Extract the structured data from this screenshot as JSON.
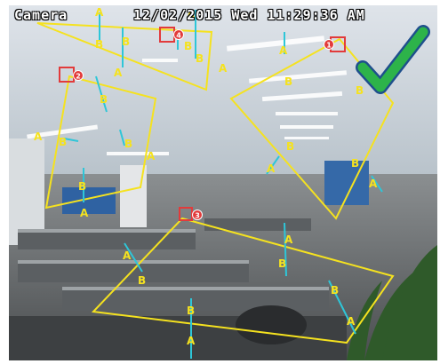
{
  "osd": {
    "camera_name": "Camera",
    "datetime": "12/02/2015 Wed 11:29:36 AM"
  },
  "zones": [
    {
      "id": "1",
      "color": "#f5e21f"
    },
    {
      "id": "2",
      "color": "#f5e21f"
    },
    {
      "id": "3",
      "color": "#f5e21f"
    },
    {
      "id": "4",
      "color": "#f5e21f"
    }
  ],
  "labels": {
    "a": "A",
    "b": "B"
  },
  "colors": {
    "zone_line": "#f5e21f",
    "direction_arrow": "#2ec6d8",
    "marker_fill": "#e23b3b",
    "checkmark": "#2db34a",
    "checkmark_outline": "#1e4f8c"
  },
  "icons": {
    "status": "checkmark-icon",
    "direction": "double-arrow-icon"
  }
}
